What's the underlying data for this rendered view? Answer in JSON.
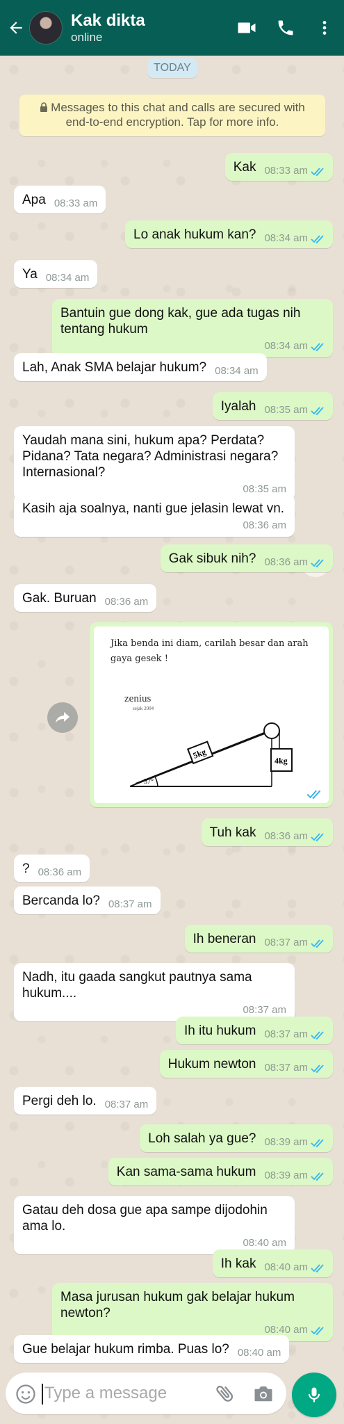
{
  "header": {
    "name": "Kak dikta",
    "status": "online"
  },
  "chat": {
    "date_chip": "TODAY",
    "encryption_notice": "Messages to this chat and calls are secured with end-to-end encryption. Tap for more info.",
    "messages": [
      {
        "dir": "out",
        "text": "Kak",
        "time": "08:33 am"
      },
      {
        "dir": "in",
        "text": "Apa",
        "time": "08:33 am"
      },
      {
        "dir": "out",
        "text": "Lo anak hukum kan?",
        "time": "08:34 am"
      },
      {
        "dir": "in",
        "text": "Ya",
        "time": "08:34 am"
      },
      {
        "dir": "out",
        "text": "Bantuin gue dong kak, gue ada tugas nih tentang hukum",
        "time": "08:34 am"
      },
      {
        "dir": "in",
        "text": "Lah, Anak SMA belajar hukum?",
        "time": "08:34 am"
      },
      {
        "dir": "out",
        "text": "Iyalah",
        "time": "08:35 am"
      },
      {
        "dir": "in",
        "text": "Yaudah mana sini, hukum apa? Perdata? Pidana? Tata negara? Administrasi negara? Internasional?",
        "time": "08:35 am"
      },
      {
        "dir": "in",
        "text": "Kasih aja soalnya, nanti gue jelasin lewat vn.",
        "time": "08:36 am"
      },
      {
        "dir": "out",
        "text": "Gak sibuk nih?",
        "time": "08:36 am"
      },
      {
        "dir": "in",
        "text": "Gak. Buruan",
        "time": "08:36 am"
      },
      {
        "dir": "out",
        "text": "Tuh kak",
        "time": "08:36 am"
      },
      {
        "dir": "in",
        "text": "?",
        "time": "08:36 am"
      },
      {
        "dir": "in",
        "text": "Bercanda lo?",
        "time": "08:37 am"
      },
      {
        "dir": "out",
        "text": "Ih beneran",
        "time": "08:37 am"
      },
      {
        "dir": "in",
        "text": "Nadh, itu gaada sangkut pautnya sama hukum....",
        "time": "08:37 am"
      },
      {
        "dir": "out",
        "text": "Ih itu hukum",
        "time": "08:37 am"
      },
      {
        "dir": "out",
        "text": "Hukum newton",
        "time": "08:37 am"
      },
      {
        "dir": "in",
        "text": "Pergi deh lo.",
        "time": "08:37 am"
      },
      {
        "dir": "out",
        "text": "Loh salah ya gue?",
        "time": "08:39 am"
      },
      {
        "dir": "out",
        "text": "Kan sama-sama hukum",
        "time": "08:39 am"
      },
      {
        "dir": "in",
        "text": "Gatau deh dosa gue apa sampe dijodohin ama lo.",
        "time": "08:40 am"
      },
      {
        "dir": "out",
        "text": "Ih kak",
        "time": "08:40 am"
      },
      {
        "dir": "out",
        "text": "Masa jurusan hukum gak belajar hukum newton?",
        "time": "08:40 am"
      },
      {
        "dir": "in",
        "text": "Gue belajar hukum rimba. Puas lo?",
        "time": "08:40 am"
      }
    ],
    "image": {
      "caption": "Jika benda ini diam, carilah besar dan arah gaya gesek !",
      "brand": "zenius",
      "brand_sub": "sejak 2004",
      "label_5kg": "5kg",
      "label_4kg": "4kg",
      "angle": "37°"
    }
  },
  "input": {
    "placeholder": "Type a message"
  },
  "colors": {
    "header": "#075e54",
    "outgoing": "#dcf8c6",
    "incoming": "#ffffff",
    "tick": "#34b7f1",
    "mic": "#00a884"
  }
}
